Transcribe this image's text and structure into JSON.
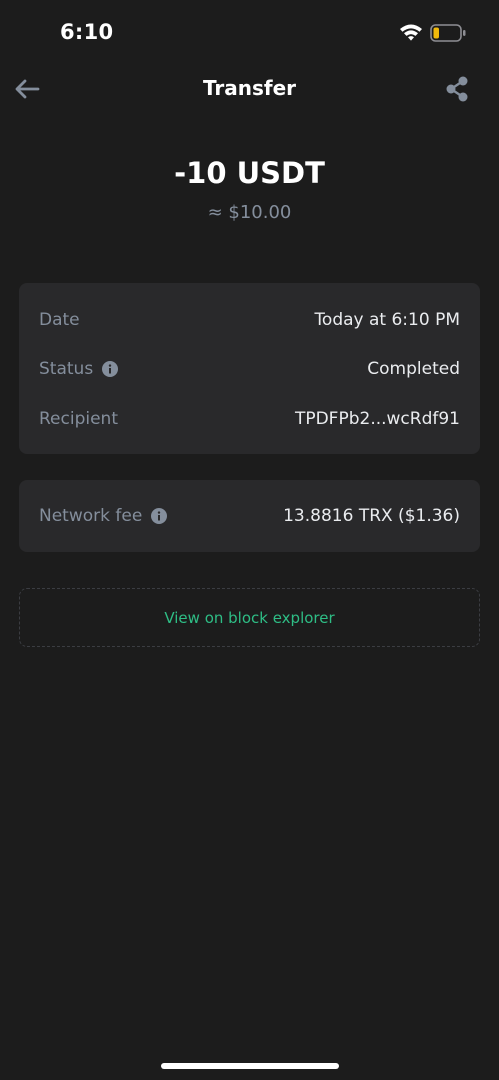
{
  "status_bar": {
    "time": "6:10",
    "icons": [
      "wifi-icon",
      "battery-icon"
    ],
    "battery_level": 0.2
  },
  "header": {
    "title": "Transfer",
    "back_icon": "arrow-left-icon",
    "share_icon": "share-icon"
  },
  "summary": {
    "amount": "-10 USDT",
    "fiat": "≈ $10.00"
  },
  "details": {
    "rows": [
      {
        "label": "Date",
        "value": "Today at 6:10 PM"
      },
      {
        "label": "Status",
        "value": "Completed"
      },
      {
        "label": "Recipient",
        "value": "TPDFPb2...wcRdf91"
      }
    ]
  },
  "fee": {
    "label": "Network fee",
    "value": "13.8816 TRX ($1.36)"
  },
  "explorer": {
    "label": "View on block explorer"
  },
  "colors": {
    "background": "#1c1c1c",
    "card": "#29292b",
    "muted_text": "#848e9c",
    "accent_green": "#2ebd85",
    "battery_yellow": "#f0b90b"
  }
}
